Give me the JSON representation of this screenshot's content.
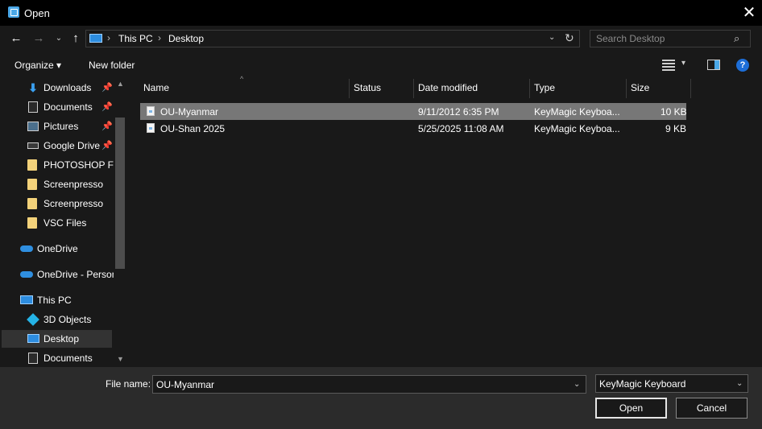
{
  "window": {
    "title": "Open",
    "close_glyph": "✕"
  },
  "nav": {
    "back_glyph": "←",
    "forward_glyph": "→",
    "recent_glyph": "⌄",
    "up_glyph": "↑",
    "breadcrumb": [
      "This PC",
      "Desktop"
    ],
    "chevron_glyph": "›",
    "address_dropdown_glyph": "⌄",
    "refresh_glyph": "↻"
  },
  "search": {
    "placeholder": "Search Desktop",
    "icon_glyph": "⌕"
  },
  "toolbar": {
    "organize_label": "Organize ▾",
    "new_folder_label": "New folder",
    "view_dropdown_glyph": "▾",
    "help_glyph": "?"
  },
  "sidebar": {
    "items": [
      {
        "label": "Downloads",
        "icon": "download-icon",
        "pinned": true
      },
      {
        "label": "Documents",
        "icon": "document-icon",
        "pinned": true
      },
      {
        "label": "Pictures",
        "icon": "pictures-icon",
        "pinned": true
      },
      {
        "label": "Google Drive",
        "icon": "drive-icon",
        "pinned": true
      },
      {
        "label": "PHOTOSHOP Files",
        "icon": "folder-icon",
        "pinned": false
      },
      {
        "label": "Screenpresso",
        "icon": "folder-icon",
        "pinned": false
      },
      {
        "label": "Screenpresso",
        "icon": "folder-icon",
        "pinned": false
      },
      {
        "label": "VSC Files",
        "icon": "folder-icon",
        "pinned": false
      },
      {
        "label": "OneDrive",
        "icon": "onedrive-icon",
        "pinned": false
      },
      {
        "label": "OneDrive - Personal",
        "icon": "onedrive-icon",
        "pinned": false
      },
      {
        "label": "This PC",
        "icon": "computer-icon",
        "pinned": false
      },
      {
        "label": "3D Objects",
        "icon": "cube-icon",
        "pinned": false
      },
      {
        "label": "Desktop",
        "icon": "desktop-icon",
        "pinned": false,
        "selected": true
      },
      {
        "label": "Documents",
        "icon": "document-icon",
        "pinned": false
      }
    ],
    "pin_glyph": "📌",
    "scroll_up_glyph": "▲",
    "scroll_down_glyph": "▼"
  },
  "file_list": {
    "columns": [
      "Name",
      "Status",
      "Date modified",
      "Type",
      "Size"
    ],
    "sort_glyph": "^",
    "rows": [
      {
        "name": "OU-Myanmar",
        "status": "",
        "date": "9/11/2012 6:35 PM",
        "type": "KeyMagic Keyboa...",
        "size": "10 KB",
        "selected": true
      },
      {
        "name": "OU-Shan 2025",
        "status": "",
        "date": "5/25/2025 11:08 AM",
        "type": "KeyMagic Keyboa...",
        "size": "9 KB",
        "selected": false
      }
    ]
  },
  "footer": {
    "file_name_label": "File name:",
    "file_name_value": "OU-Myanmar",
    "file_type_value": "KeyMagic Keyboard",
    "dropdown_glyph": "⌄",
    "open_label": "Open",
    "cancel_label": "Cancel"
  },
  "colors": {
    "background": "#191919",
    "selection": "#777777",
    "accent": "#2d8de0"
  }
}
